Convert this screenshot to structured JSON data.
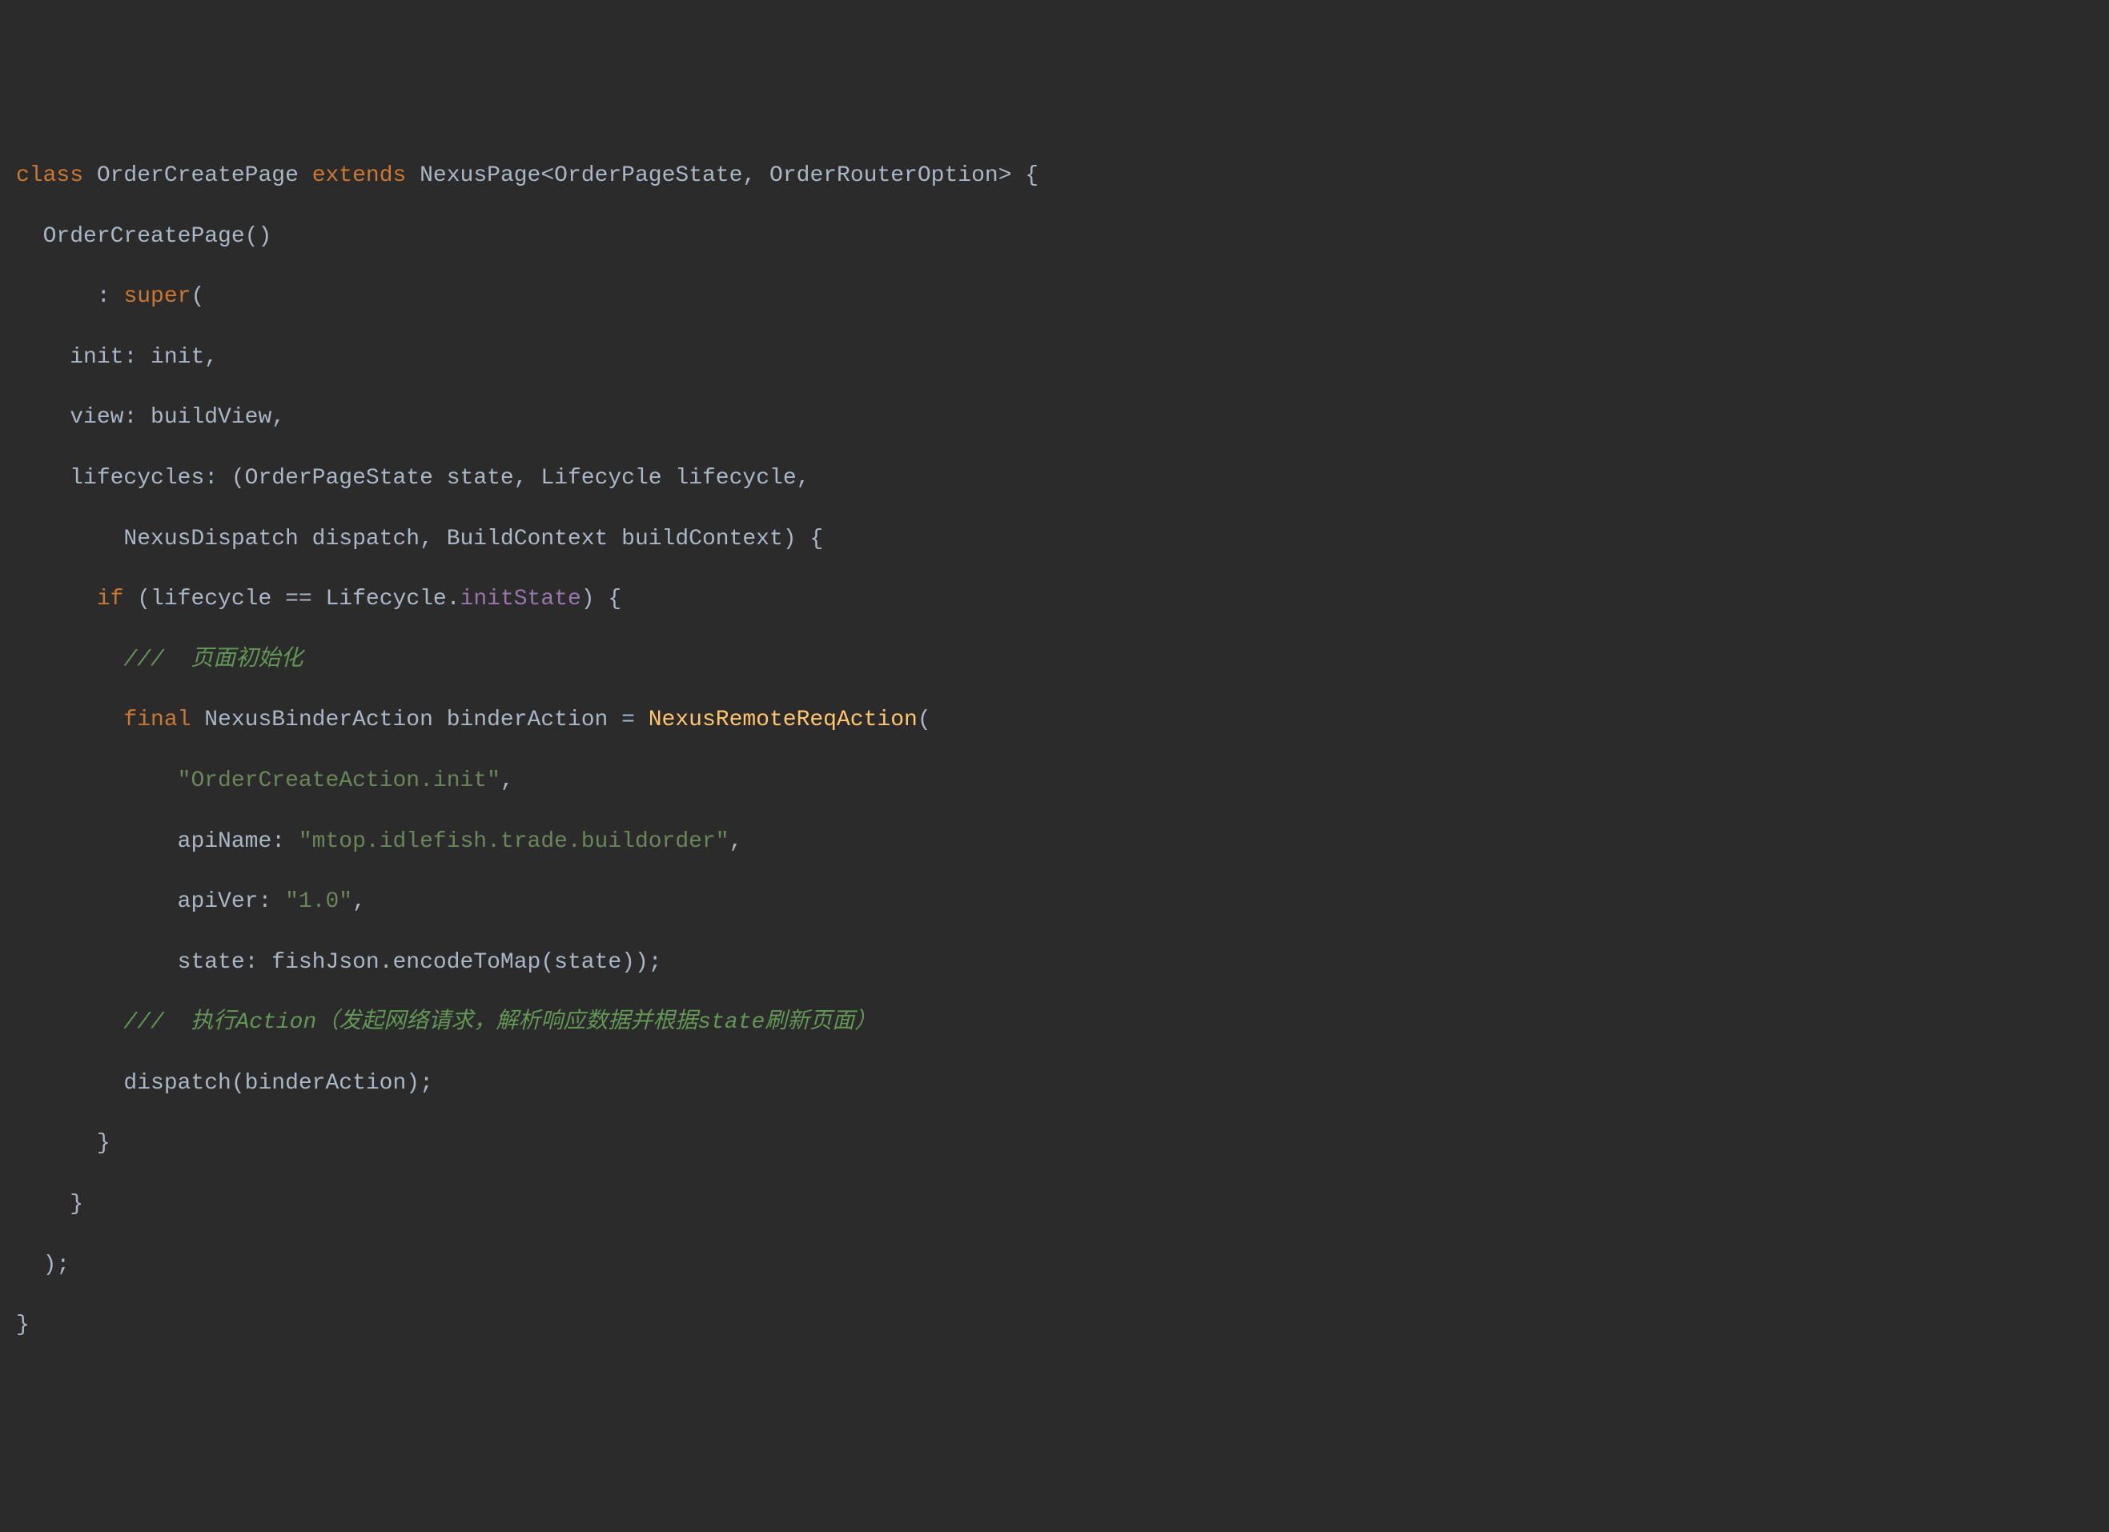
{
  "code": {
    "line1": {
      "kw_class": "class",
      "class_name": "OrderCreatePage",
      "kw_extends": "extends",
      "base_class": "NexusPage",
      "generic_open": "<",
      "generic_arg1": "OrderPageState",
      "generic_sep": ", ",
      "generic_arg2": "OrderRouterOption",
      "generic_close": ">",
      "brace_open": " {"
    },
    "line2": {
      "ctor_name": "OrderCreatePage",
      "parens": "()"
    },
    "line3": {
      "colon": ": ",
      "kw_super": "super",
      "paren_open": "("
    },
    "line4": {
      "arg_name": "init",
      "colon": ": ",
      "arg_val": "init",
      "comma": ","
    },
    "line5": {
      "arg_name": "view",
      "colon": ": ",
      "arg_val": "buildView",
      "comma": ","
    },
    "line6": {
      "arg_name": "lifecycles",
      "colon": ": ",
      "paren_open": "(",
      "type1": "OrderPageState",
      "param1": " state",
      "sep1": ", ",
      "type2": "Lifecycle",
      "param2": " lifecycle",
      "comma": ","
    },
    "line7": {
      "type3": "NexusDispatch",
      "param3": " dispatch",
      "sep": ", ",
      "type4": "BuildContext",
      "param4": " buildContext",
      "paren_close": ")",
      "brace_open": " {"
    },
    "line8": {
      "kw_if": "if",
      "paren_open": " (",
      "lhs": "lifecycle",
      "op": " == ",
      "rhs_obj": "Lifecycle",
      "dot": ".",
      "rhs_prop": "initState",
      "paren_close": ")",
      "brace_open": " {"
    },
    "line9": {
      "comment": "///  页面初始化"
    },
    "line10": {
      "kw_final": "final",
      "type": " NexusBinderAction",
      "var_name": " binderAction",
      "op": " = ",
      "func": "NexusRemoteReqAction",
      "paren_open": "("
    },
    "line11": {
      "string": "\"OrderCreateAction.init\"",
      "comma": ","
    },
    "line12": {
      "arg_name": "apiName",
      "colon": ": ",
      "string": "\"mtop.idlefish.trade.buildorder\"",
      "comma": ","
    },
    "line13": {
      "arg_name": "apiVer",
      "colon": ": ",
      "string": "\"1.0\"",
      "comma": ","
    },
    "line14": {
      "arg_name": "state",
      "colon": ": ",
      "obj": "fishJson",
      "dot": ".",
      "method": "encodeToMap",
      "paren_open": "(",
      "inner_arg": "state",
      "paren_close": ")",
      "outer_close": ")",
      "semicolon": ";"
    },
    "line15": {
      "comment": "///  执行Action（发起网络请求，解析响应数据并根据state刷新页面）"
    },
    "line16": {
      "func": "dispatch",
      "paren_open": "(",
      "arg": "binderAction",
      "paren_close": ")",
      "semicolon": ";"
    },
    "line17": {
      "brace_close": "}"
    },
    "line18": {
      "brace_close": "}"
    },
    "line19": {
      "paren_close": ")",
      "semicolon": ";"
    },
    "line20": {
      "brace_close": "}"
    }
  }
}
